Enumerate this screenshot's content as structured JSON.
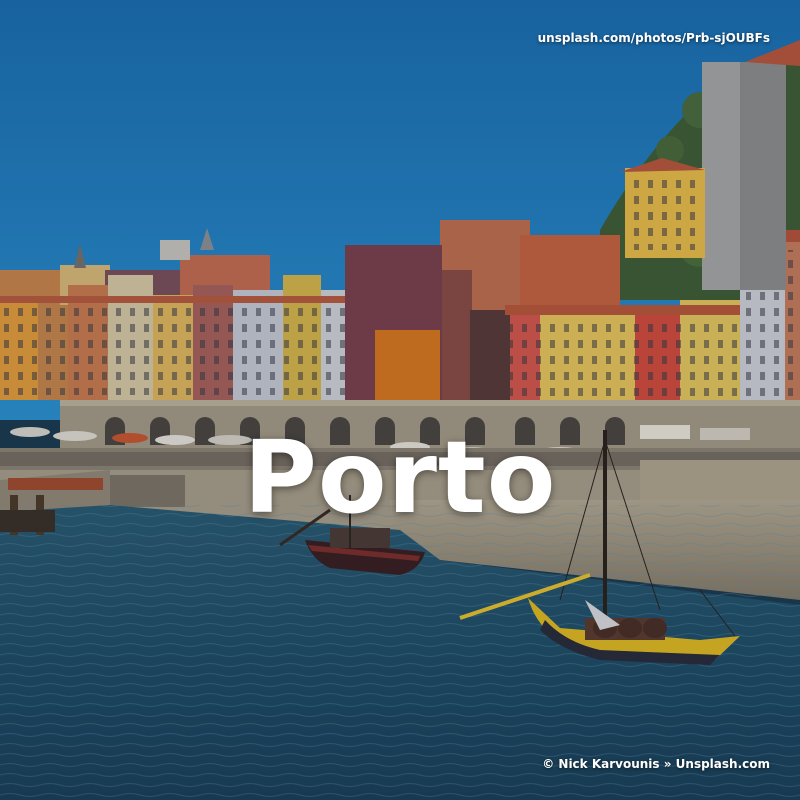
{
  "source_url": "unsplash.com/photos/Prb-sjOUBFs",
  "title": "Porto",
  "credit": "© Nick Karvounis » Unsplash.com",
  "colors": {
    "sky_top": "#1a6fb0",
    "sky_bottom": "#2b8fcf",
    "river": "#1f4b63",
    "quay_wall": "#a59a86",
    "boat_yellow": "#e0b820"
  }
}
